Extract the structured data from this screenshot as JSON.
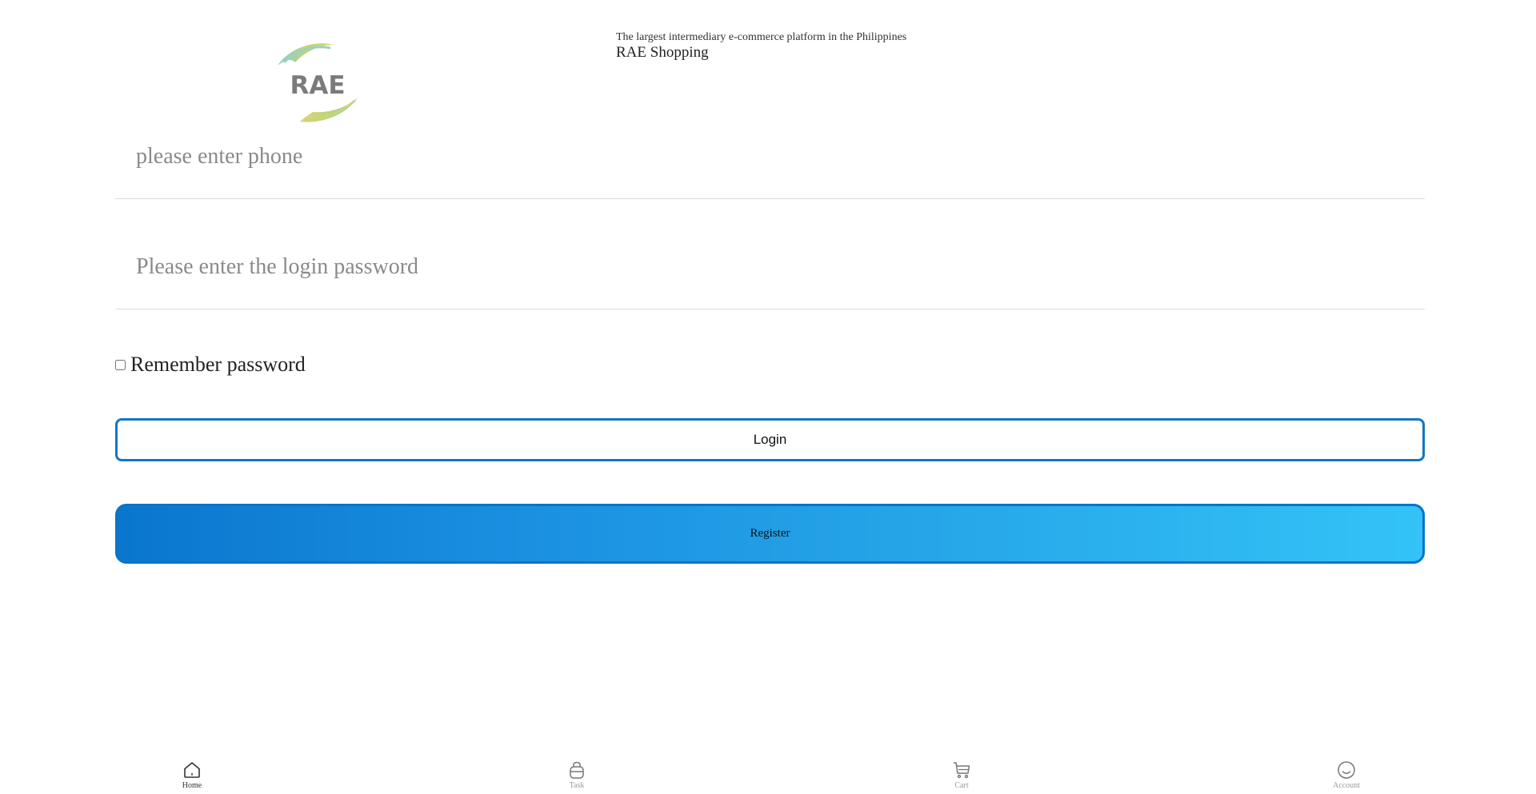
{
  "header": {
    "logo_text": "RAE",
    "tagline": "The largest intermediary e-commerce platform in the Philippines",
    "brand": "RAE Shopping"
  },
  "form": {
    "phone_placeholder": "please enter phone",
    "password_placeholder": "Please enter the login password",
    "remember_label": "Remember password",
    "login_label": "Login",
    "register_label": "Register"
  },
  "bottom_nav": {
    "items": [
      {
        "label": "Home",
        "icon": "home-icon",
        "active": true
      },
      {
        "label": "Task",
        "icon": "bag-icon",
        "active": false
      },
      {
        "label": "Cart",
        "icon": "cart-icon",
        "active": false
      },
      {
        "label": "Account",
        "icon": "smiley-icon",
        "active": false
      }
    ]
  },
  "colors": {
    "accent": "#1476c4",
    "register_gradient_start": "#0a76cd",
    "register_gradient_end": "#33c3f7"
  }
}
